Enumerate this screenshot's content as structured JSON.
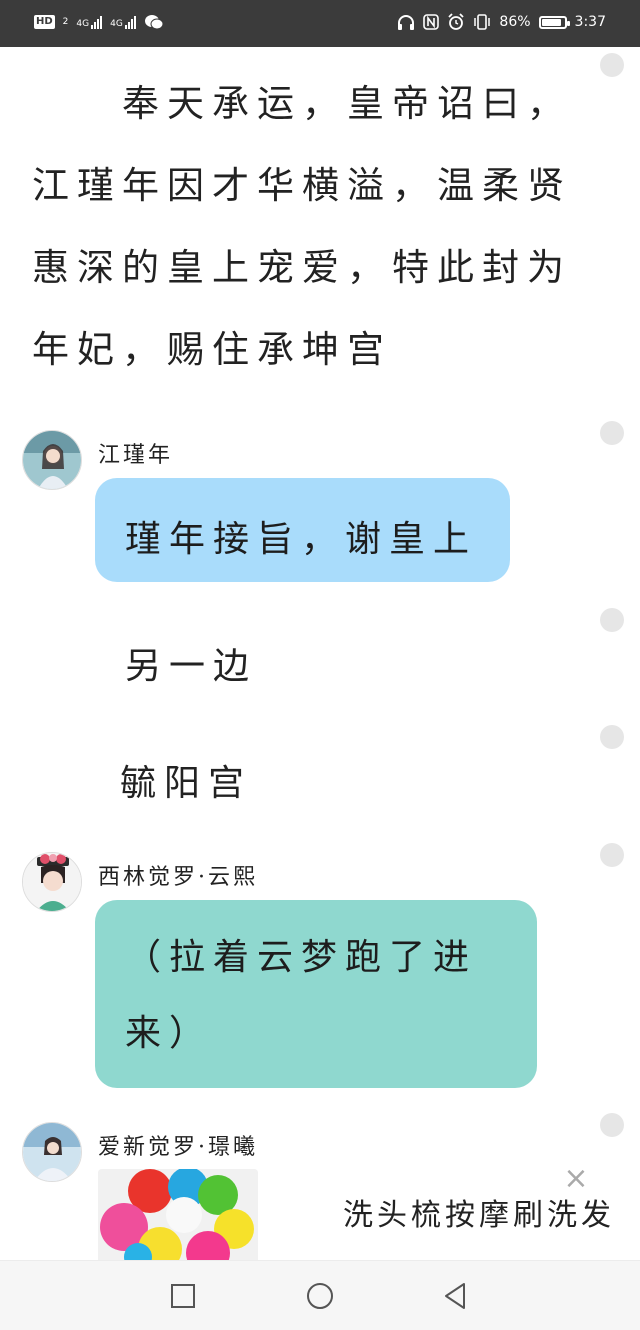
{
  "status_bar": {
    "hd_badge": "HD",
    "sim_slot": "2",
    "network1": "4G",
    "network2": "4G",
    "battery_percent": "86%",
    "battery_level": 0.86,
    "time": "3:37",
    "icons": [
      "headphones-icon",
      "nfc-icon",
      "alarm-icon",
      "vibrate-icon",
      "battery-icon",
      "wechat-icon"
    ]
  },
  "chat": {
    "narration_lines": [
      "奉天承运，皇帝诏曰，",
      "江瑾年因才华横溢，温柔贤",
      "惠深的皇上宠爱，特此封为",
      "年妃，赐住承坤宫"
    ],
    "msg1": {
      "speaker": "江瑾年",
      "text": "瑾年接旨，谢皇上"
    },
    "scene1": "另一边",
    "scene2": "毓阳宫",
    "msg2": {
      "speaker": "西林觉罗·云熙",
      "line1": "（拉着云梦跑了进",
      "line2": "来）"
    },
    "msg3": {
      "speaker": "爱新觉罗·璟曦"
    }
  },
  "ad": {
    "title": "洗头梳按摩刷洗发",
    "close": "×"
  }
}
